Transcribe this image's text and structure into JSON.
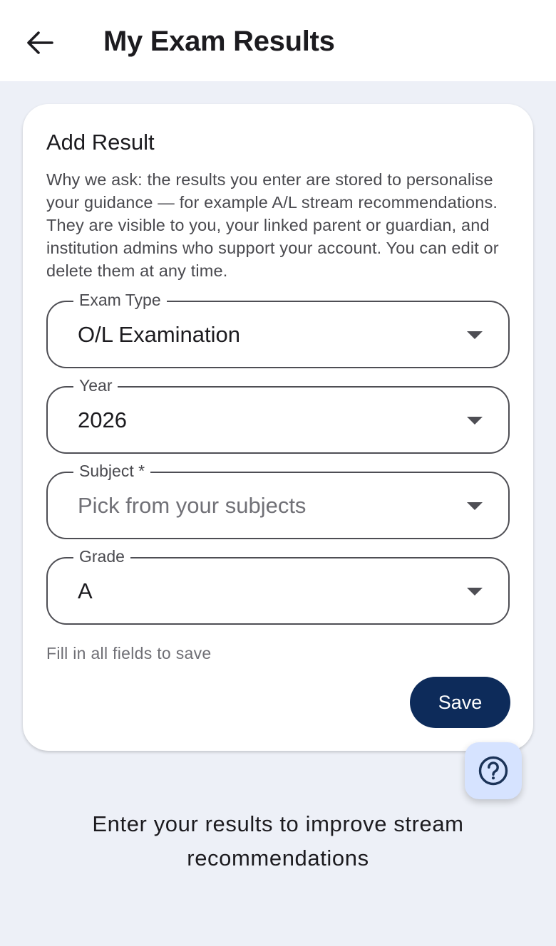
{
  "app_bar": {
    "title": "My Exam Results",
    "back_icon": "arrow-left-icon"
  },
  "card": {
    "title": "Add Result",
    "description": "Why we ask: the results you enter are stored to personalise your guidance — for example A/L stream recommendations. They are visible to you, your linked parent or guardian, and institution admins who support your account. You can edit or delete them at any time.",
    "fields": [
      {
        "label": "Exam Type",
        "value": "O/L Examination",
        "placeholder": ""
      },
      {
        "label": "Year",
        "value": "2026",
        "placeholder": ""
      },
      {
        "label": "Subject *",
        "value": "",
        "placeholder": "Pick from your subjects"
      },
      {
        "label": "Grade",
        "value": "A",
        "placeholder": ""
      }
    ],
    "helper_text": "Fill in all fields to save",
    "save_label": "Save"
  },
  "help_button": {
    "icon": "help-circle-icon"
  },
  "footer": {
    "message": "Enter your results to improve stream recommendations"
  },
  "colors": {
    "background": "#edf0f7",
    "primary": "#0d2b5a",
    "fab": "#d6e3ff"
  }
}
